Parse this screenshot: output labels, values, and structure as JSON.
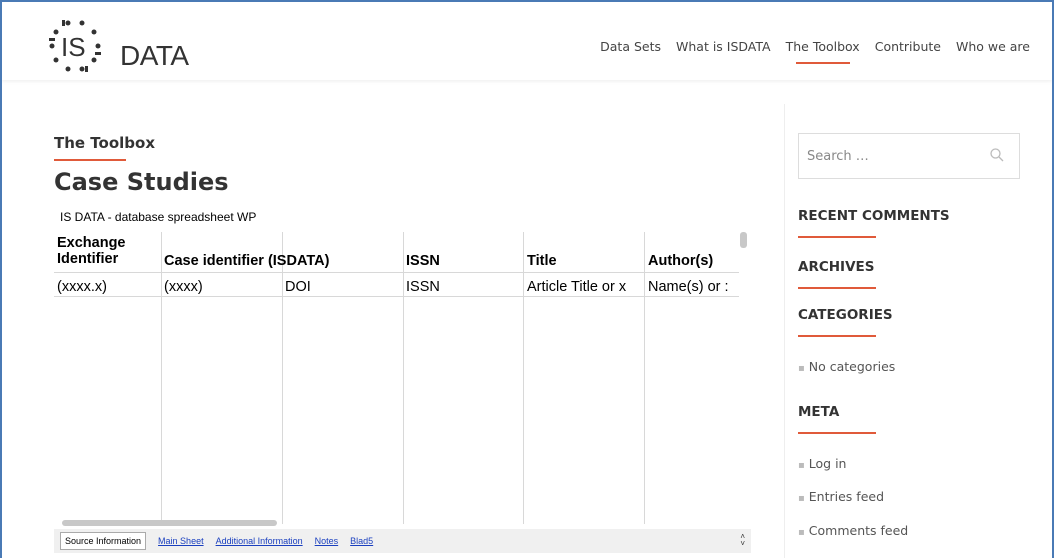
{
  "site": {
    "logo_text": "DATA",
    "logo_mark": "IS"
  },
  "nav": [
    {
      "label": "Data Sets"
    },
    {
      "label": "What is ISDATA"
    },
    {
      "label": "The Toolbox"
    },
    {
      "label": "Contribute"
    },
    {
      "label": "Who we are"
    }
  ],
  "main": {
    "breadcrumb": "The Toolbox",
    "title": "Case Studies"
  },
  "sheet": {
    "caption": "IS DATA - database spreadsheet WP",
    "headers": [
      "Exchange\nIdentifier",
      "Case identifier (ISDATA)",
      "",
      "ISSN",
      "Title",
      "Author(s)"
    ],
    "row1": [
      "(xxxx.x)",
      "(xxxx)",
      "DOI",
      "ISSN",
      "Article Title or x",
      "Name(s) or :"
    ],
    "tabs": [
      {
        "label": "Source Information"
      },
      {
        "label": "Main Sheet"
      },
      {
        "label": "Additional Information"
      },
      {
        "label": "Notes"
      },
      {
        "label": "Blad5"
      }
    ]
  },
  "sidebar": {
    "search_placeholder": "Search …",
    "recent_comments": "RECENT COMMENTS",
    "archives": "ARCHIVES",
    "categories": "CATEGORIES",
    "no_categories": "No categories",
    "meta": "META",
    "meta_items": [
      "Log in",
      "Entries feed",
      "Comments feed"
    ]
  },
  "colors": {
    "accent": "#e05a3a",
    "frame": "#4a7ab5",
    "link": "#1a3fbf"
  }
}
